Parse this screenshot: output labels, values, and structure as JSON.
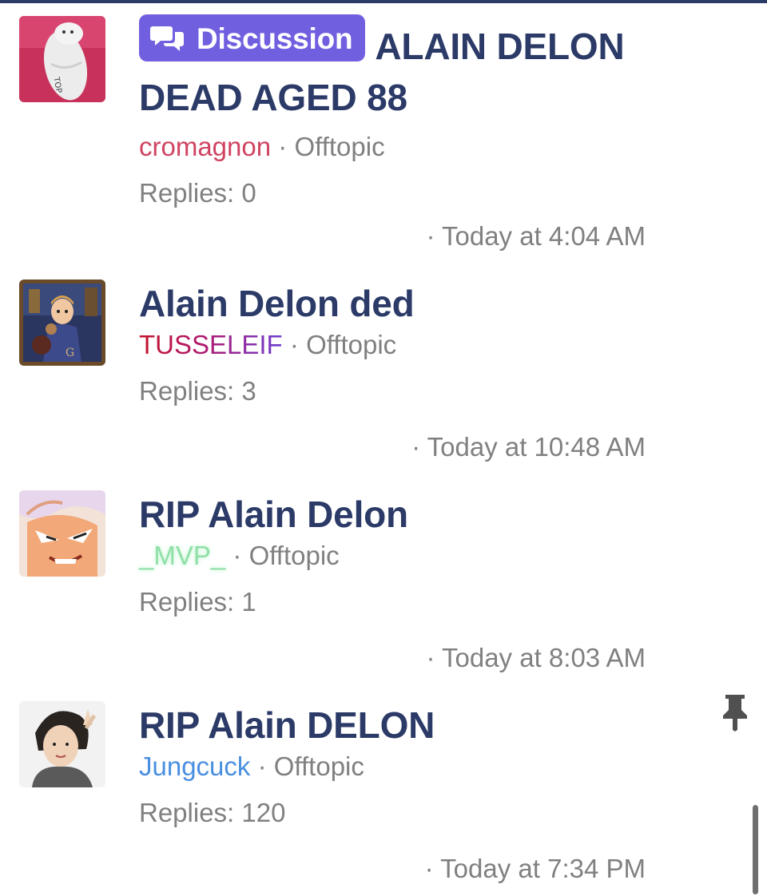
{
  "threads": [
    {
      "prefix_label": "Discussion",
      "title": "ALAIN DELON DEAD AGED 88",
      "author": "cromagnon",
      "separator": "·",
      "forum": "Offtopic",
      "replies": "Replies: 0",
      "time": "· Today at 4:04 AM",
      "avatar": "pig-doll-avatar"
    },
    {
      "title": "Alain Delon ded",
      "author": "TUSSELEIF",
      "separator": "·",
      "forum": "Offtopic",
      "replies": "Replies: 3",
      "time": "· Today at 10:48 AM",
      "avatar": "cartoon-wizard-avatar"
    },
    {
      "title": "RIP Alain Delon",
      "author": "_MVP_",
      "separator": "·",
      "forum": "Offtopic",
      "replies": "Replies: 1",
      "time": "· Today at 8:03 AM",
      "avatar": "anime-character-avatar"
    },
    {
      "title": "RIP Alain DELON",
      "author": "Jungcuck",
      "separator": "·",
      "forum": "Offtopic",
      "replies": "Replies: 120",
      "time": "· Today at 7:34 PM",
      "avatar": "person-photo-avatar",
      "pinned": true,
      "pin_icon": "thumbtack-icon"
    }
  ],
  "colors": {
    "title": "#2b3a67",
    "meta": "#808080",
    "badge": "#7060e0",
    "cromagnon": "#d04462",
    "jungcuck": "#4a8fe0",
    "mvp": "#8fe0a8"
  }
}
